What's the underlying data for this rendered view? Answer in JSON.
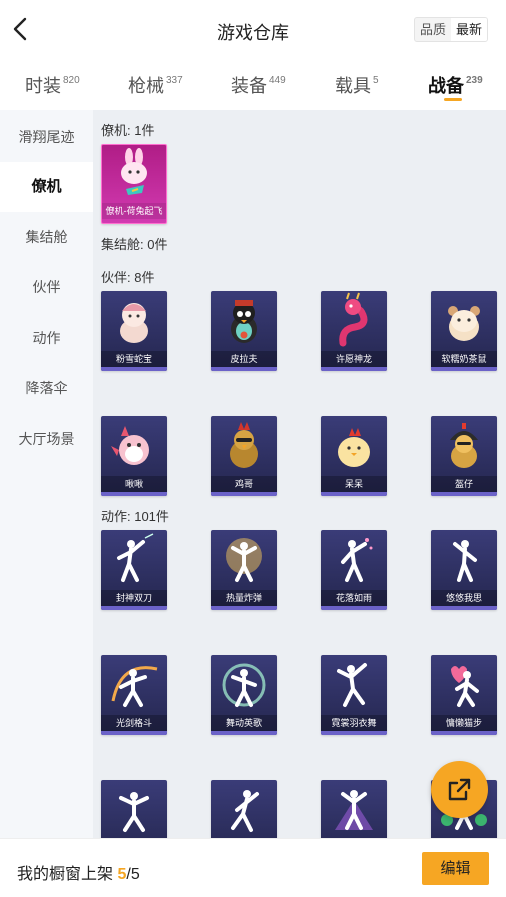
{
  "header": {
    "title": "游戏仓库",
    "sort_options": [
      "品质",
      "最新"
    ],
    "active_sort": "最新"
  },
  "tabs": [
    {
      "label": "时装",
      "count": "820"
    },
    {
      "label": "枪械",
      "count": "337"
    },
    {
      "label": "装备",
      "count": "449"
    },
    {
      "label": "载具",
      "count": "5"
    },
    {
      "label": "战备",
      "count": "239",
      "active": true
    }
  ],
  "sidebar": {
    "items": [
      {
        "label": "滑翔尾迹"
      },
      {
        "label": "僚机",
        "active": true
      },
      {
        "label": "集结舱"
      },
      {
        "label": "伙伴"
      },
      {
        "label": "动作"
      },
      {
        "label": "降落伞"
      },
      {
        "label": "大厅场景"
      }
    ]
  },
  "sections": {
    "wingman": {
      "title": "僚机: 1件",
      "items": [
        {
          "name": "僚机-荷兔起飞",
          "icon": "bunny-wingman-icon"
        }
      ]
    },
    "pod": {
      "title": "集结舱: 0件"
    },
    "partner": {
      "title": "伙伴: 8件",
      "items": [
        {
          "name": "粉雪蛇宝",
          "icon": "snow-snake-icon"
        },
        {
          "name": "皮拉夫",
          "icon": "penguin-icon"
        },
        {
          "name": "许愿神龙",
          "icon": "dragon-icon"
        },
        {
          "name": "软糯奶茶鼠",
          "icon": "hamster-icon"
        },
        {
          "name": "啾啾",
          "icon": "bird-icon"
        },
        {
          "name": "鸡哥",
          "icon": "rooster-icon"
        },
        {
          "name": "呆呆",
          "icon": "chick-icon"
        },
        {
          "name": "盔仔",
          "icon": "helmet-chick-icon"
        }
      ]
    },
    "emote": {
      "title": "动作: 101件",
      "items": [
        {
          "name": "封神双刀",
          "icon": "dance-icon"
        },
        {
          "name": "热量炸弹",
          "icon": "dance-icon"
        },
        {
          "name": "花落如雨",
          "icon": "dance-icon"
        },
        {
          "name": "悠悠我思",
          "icon": "dance-icon"
        },
        {
          "name": "光剑格斗",
          "icon": "dance-icon"
        },
        {
          "name": "舞动英歌",
          "icon": "dance-icon"
        },
        {
          "name": "霓裳羽衣舞",
          "icon": "dance-icon"
        },
        {
          "name": "慵懒猫步",
          "icon": "dance-icon"
        },
        {
          "name": "",
          "icon": "dance-icon"
        },
        {
          "name": "",
          "icon": "dance-icon"
        },
        {
          "name": "",
          "icon": "dance-icon"
        },
        {
          "name": "",
          "icon": "dance-icon"
        }
      ]
    }
  },
  "bottom": {
    "showcase_label": "我的橱窗上架",
    "showcase_used": "5",
    "showcase_sep": "/",
    "showcase_total": "5",
    "edit_label": "编辑"
  },
  "colors": {
    "accent": "#f6a623",
    "card_purple": "#2f3164",
    "card_pink": "#c42b9e"
  }
}
